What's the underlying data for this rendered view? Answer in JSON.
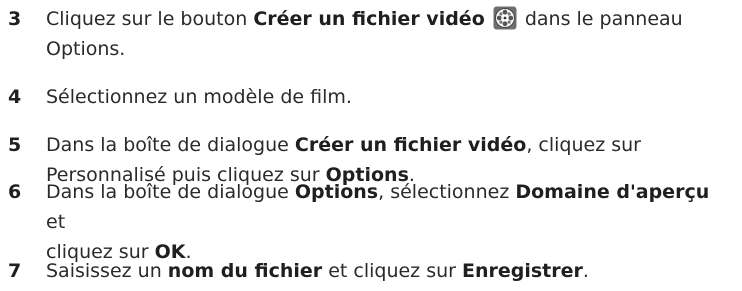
{
  "steps": [
    {
      "number": "3",
      "line1_prefix": "Cliquez sur le bouton ",
      "line1_bold": "Créer un fichier vidéo",
      "line1_suffix": " dans le panneau",
      "line2": "Options.",
      "icon": "film-reel-icon"
    },
    {
      "number": "4",
      "text": "Sélectionnez un modèle de film."
    },
    {
      "number": "5",
      "line1_prefix": "Dans la boîte de dialogue ",
      "line1_bold": "Créer un fichier vidéo",
      "line1_suffix": ", cliquez sur",
      "line2_prefix": "Personnalisé puis cliquez sur ",
      "line2_bold": "Options",
      "line2_suffix": "."
    },
    {
      "number": "6",
      "line1_prefix": "Dans la boîte de dialogue ",
      "line1_bold1": "Options",
      "line1_middle": ", sélectionnez ",
      "line1_bold2": "Domaine d'aperçu",
      "line1_suffix": " et",
      "line2_prefix": "cliquez sur ",
      "line2_bold": "OK",
      "line2_suffix": "."
    },
    {
      "number": "7",
      "prefix": "Saisissez un ",
      "bold1": "nom du fichier",
      "middle": " et cliquez sur ",
      "bold2": "Enregistrer",
      "suffix": "."
    }
  ],
  "colors": {
    "text": "#2a2a2a",
    "icon_fill": "#7a7a7a"
  }
}
